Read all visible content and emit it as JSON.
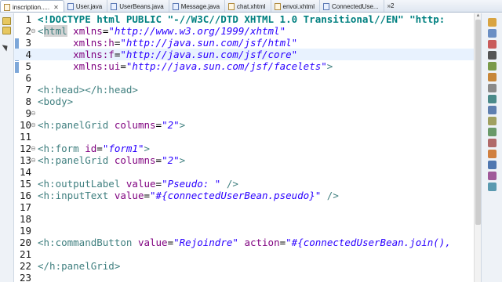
{
  "tabs": [
    {
      "label": "inscription.....",
      "kind": "xhtml",
      "active": true,
      "close": "✕"
    },
    {
      "label": "User.java",
      "kind": "java",
      "active": false
    },
    {
      "label": "UserBeans.java",
      "kind": "java",
      "active": false
    },
    {
      "label": "Message.java",
      "kind": "java",
      "active": false
    },
    {
      "label": "chat.xhtml",
      "kind": "xhtml",
      "active": false
    },
    {
      "label": "envoi.xhtml",
      "kind": "xhtml",
      "active": false
    },
    {
      "label": "ConnectedUse...",
      "kind": "java",
      "active": false
    }
  ],
  "tab_overflow": "»2",
  "editor": {
    "current_line": 4,
    "lines": [
      {
        "n": "1",
        "fold": "",
        "seg": [
          [
            "dt",
            "<!DOCTYPE html PUBLIC \"-//W3C//DTD XHTML 1.0 Transitional//EN\" \"http:"
          ]
        ]
      },
      {
        "n": "2",
        "fold": "⊖",
        "seg": [
          [
            "tg",
            "<"
          ],
          [
            "tg hl",
            "html"
          ],
          [
            "pl",
            " "
          ],
          [
            "at",
            "xmlns"
          ],
          [
            "pl",
            "="
          ],
          [
            "av",
            "\"http://www.w3.org/1999/xhtml\""
          ]
        ]
      },
      {
        "n": "3",
        "fold": "",
        "seg": [
          [
            "pl",
            "      "
          ],
          [
            "at",
            "xmlns:h"
          ],
          [
            "pl",
            "="
          ],
          [
            "av",
            "\"http://java.sun.com/jsf/html\""
          ]
        ]
      },
      {
        "n": "4",
        "fold": "",
        "seg": [
          [
            "pl",
            "      "
          ],
          [
            "at",
            "xmlns:f"
          ],
          [
            "pl",
            "="
          ],
          [
            "av",
            "\"http://java.sun.com/jsf/core\""
          ]
        ]
      },
      {
        "n": "5",
        "fold": "",
        "seg": [
          [
            "pl",
            "      "
          ],
          [
            "at",
            "xmlns:ui"
          ],
          [
            "pl",
            "="
          ],
          [
            "av",
            "\"http://java.sun.com/jsf/facelets\""
          ],
          [
            "tg",
            ">"
          ]
        ]
      },
      {
        "n": "6",
        "fold": "",
        "seg": []
      },
      {
        "n": "7",
        "fold": "",
        "seg": [
          [
            "tg",
            "<h:head></h:head>"
          ]
        ]
      },
      {
        "n": "8",
        "fold": "",
        "seg": [
          [
            "tg",
            "<body>"
          ]
        ]
      },
      {
        "n": "9",
        "fold": "⊖",
        "seg": []
      },
      {
        "n": "10",
        "fold": "⊖",
        "seg": [
          [
            "tg",
            "<h:panelGrid"
          ],
          [
            "pl",
            " "
          ],
          [
            "at",
            "columns"
          ],
          [
            "pl",
            "="
          ],
          [
            "av",
            "\"2\""
          ],
          [
            "tg",
            ">"
          ]
        ]
      },
      {
        "n": "11",
        "fold": "",
        "seg": []
      },
      {
        "n": "12",
        "fold": "⊖",
        "seg": [
          [
            "tg",
            "<h:form"
          ],
          [
            "pl",
            " "
          ],
          [
            "at",
            "id"
          ],
          [
            "pl",
            "="
          ],
          [
            "av",
            "\"form1\""
          ],
          [
            "tg",
            ">"
          ]
        ]
      },
      {
        "n": "13",
        "fold": "⊖",
        "seg": [
          [
            "tg",
            "<h:panelGrid"
          ],
          [
            "pl",
            " "
          ],
          [
            "at",
            "columns"
          ],
          [
            "pl",
            "="
          ],
          [
            "av",
            "\"2\""
          ],
          [
            "tg",
            ">"
          ]
        ]
      },
      {
        "n": "14",
        "fold": "",
        "seg": []
      },
      {
        "n": "15",
        "fold": "",
        "seg": [
          [
            "tg",
            "<h:outputLabel"
          ],
          [
            "pl",
            " "
          ],
          [
            "at",
            "value"
          ],
          [
            "pl",
            "="
          ],
          [
            "av",
            "\"Pseudo: \""
          ],
          [
            "pl",
            " "
          ],
          [
            "tg",
            "/>"
          ]
        ]
      },
      {
        "n": "16",
        "fold": "",
        "seg": [
          [
            "tg",
            "<h:inputText"
          ],
          [
            "pl",
            " "
          ],
          [
            "at",
            "value"
          ],
          [
            "pl",
            "="
          ],
          [
            "av",
            "\"#{connectedUserBean.pseudo}\""
          ],
          [
            "pl",
            " "
          ],
          [
            "tg",
            "/>"
          ]
        ]
      },
      {
        "n": "17",
        "fold": "",
        "seg": []
      },
      {
        "n": "18",
        "fold": "",
        "seg": []
      },
      {
        "n": "19",
        "fold": "",
        "seg": []
      },
      {
        "n": "20",
        "fold": "",
        "seg": [
          [
            "tg",
            "<h:commandButton"
          ],
          [
            "pl",
            " "
          ],
          [
            "at",
            "value"
          ],
          [
            "pl",
            "="
          ],
          [
            "av",
            "\"Rejoindre\""
          ],
          [
            "pl",
            " "
          ],
          [
            "at",
            "action"
          ],
          [
            "pl",
            "="
          ],
          [
            "av",
            "\"#{connectedUserBean.join(),"
          ]
        ]
      },
      {
        "n": "21",
        "fold": "",
        "seg": []
      },
      {
        "n": "22",
        "fold": "",
        "seg": [
          [
            "tg",
            "</h:panelGrid>"
          ]
        ]
      },
      {
        "n": "23",
        "fold": "",
        "seg": []
      }
    ]
  },
  "left_strip_icons": [
    "folder-icon",
    "folder-icon",
    "mouse-pointer-icon"
  ],
  "right_toolbar_icons": [
    {
      "name": "outline-icon",
      "color": "#d9a441"
    },
    {
      "name": "task-list-icon",
      "color": "#6b8fc4"
    },
    {
      "name": "problems-icon",
      "color": "#c95c5c"
    },
    {
      "name": "console-icon",
      "color": "#555555"
    },
    {
      "name": "search-icon",
      "color": "#7a9a4a"
    },
    {
      "name": "servers-icon",
      "color": "#c7873a"
    },
    {
      "name": "properties-icon",
      "color": "#8a8a8a"
    },
    {
      "name": "data-source-icon",
      "color": "#4a8a8a"
    },
    {
      "name": "snippets-icon",
      "color": "#5e7fb0"
    },
    {
      "name": "history-icon",
      "color": "#a0a060"
    },
    {
      "name": "navigator-icon",
      "color": "#6a9a6a"
    },
    {
      "name": "markers-icon",
      "color": "#b06a6a"
    },
    {
      "name": "palette-icon",
      "color": "#d08040"
    },
    {
      "name": "bookmarks-icon",
      "color": "#4f77b0"
    },
    {
      "name": "call-hierarchy-icon",
      "color": "#a05a9a"
    },
    {
      "name": "javadoc-icon",
      "color": "#5a9ab0"
    }
  ]
}
